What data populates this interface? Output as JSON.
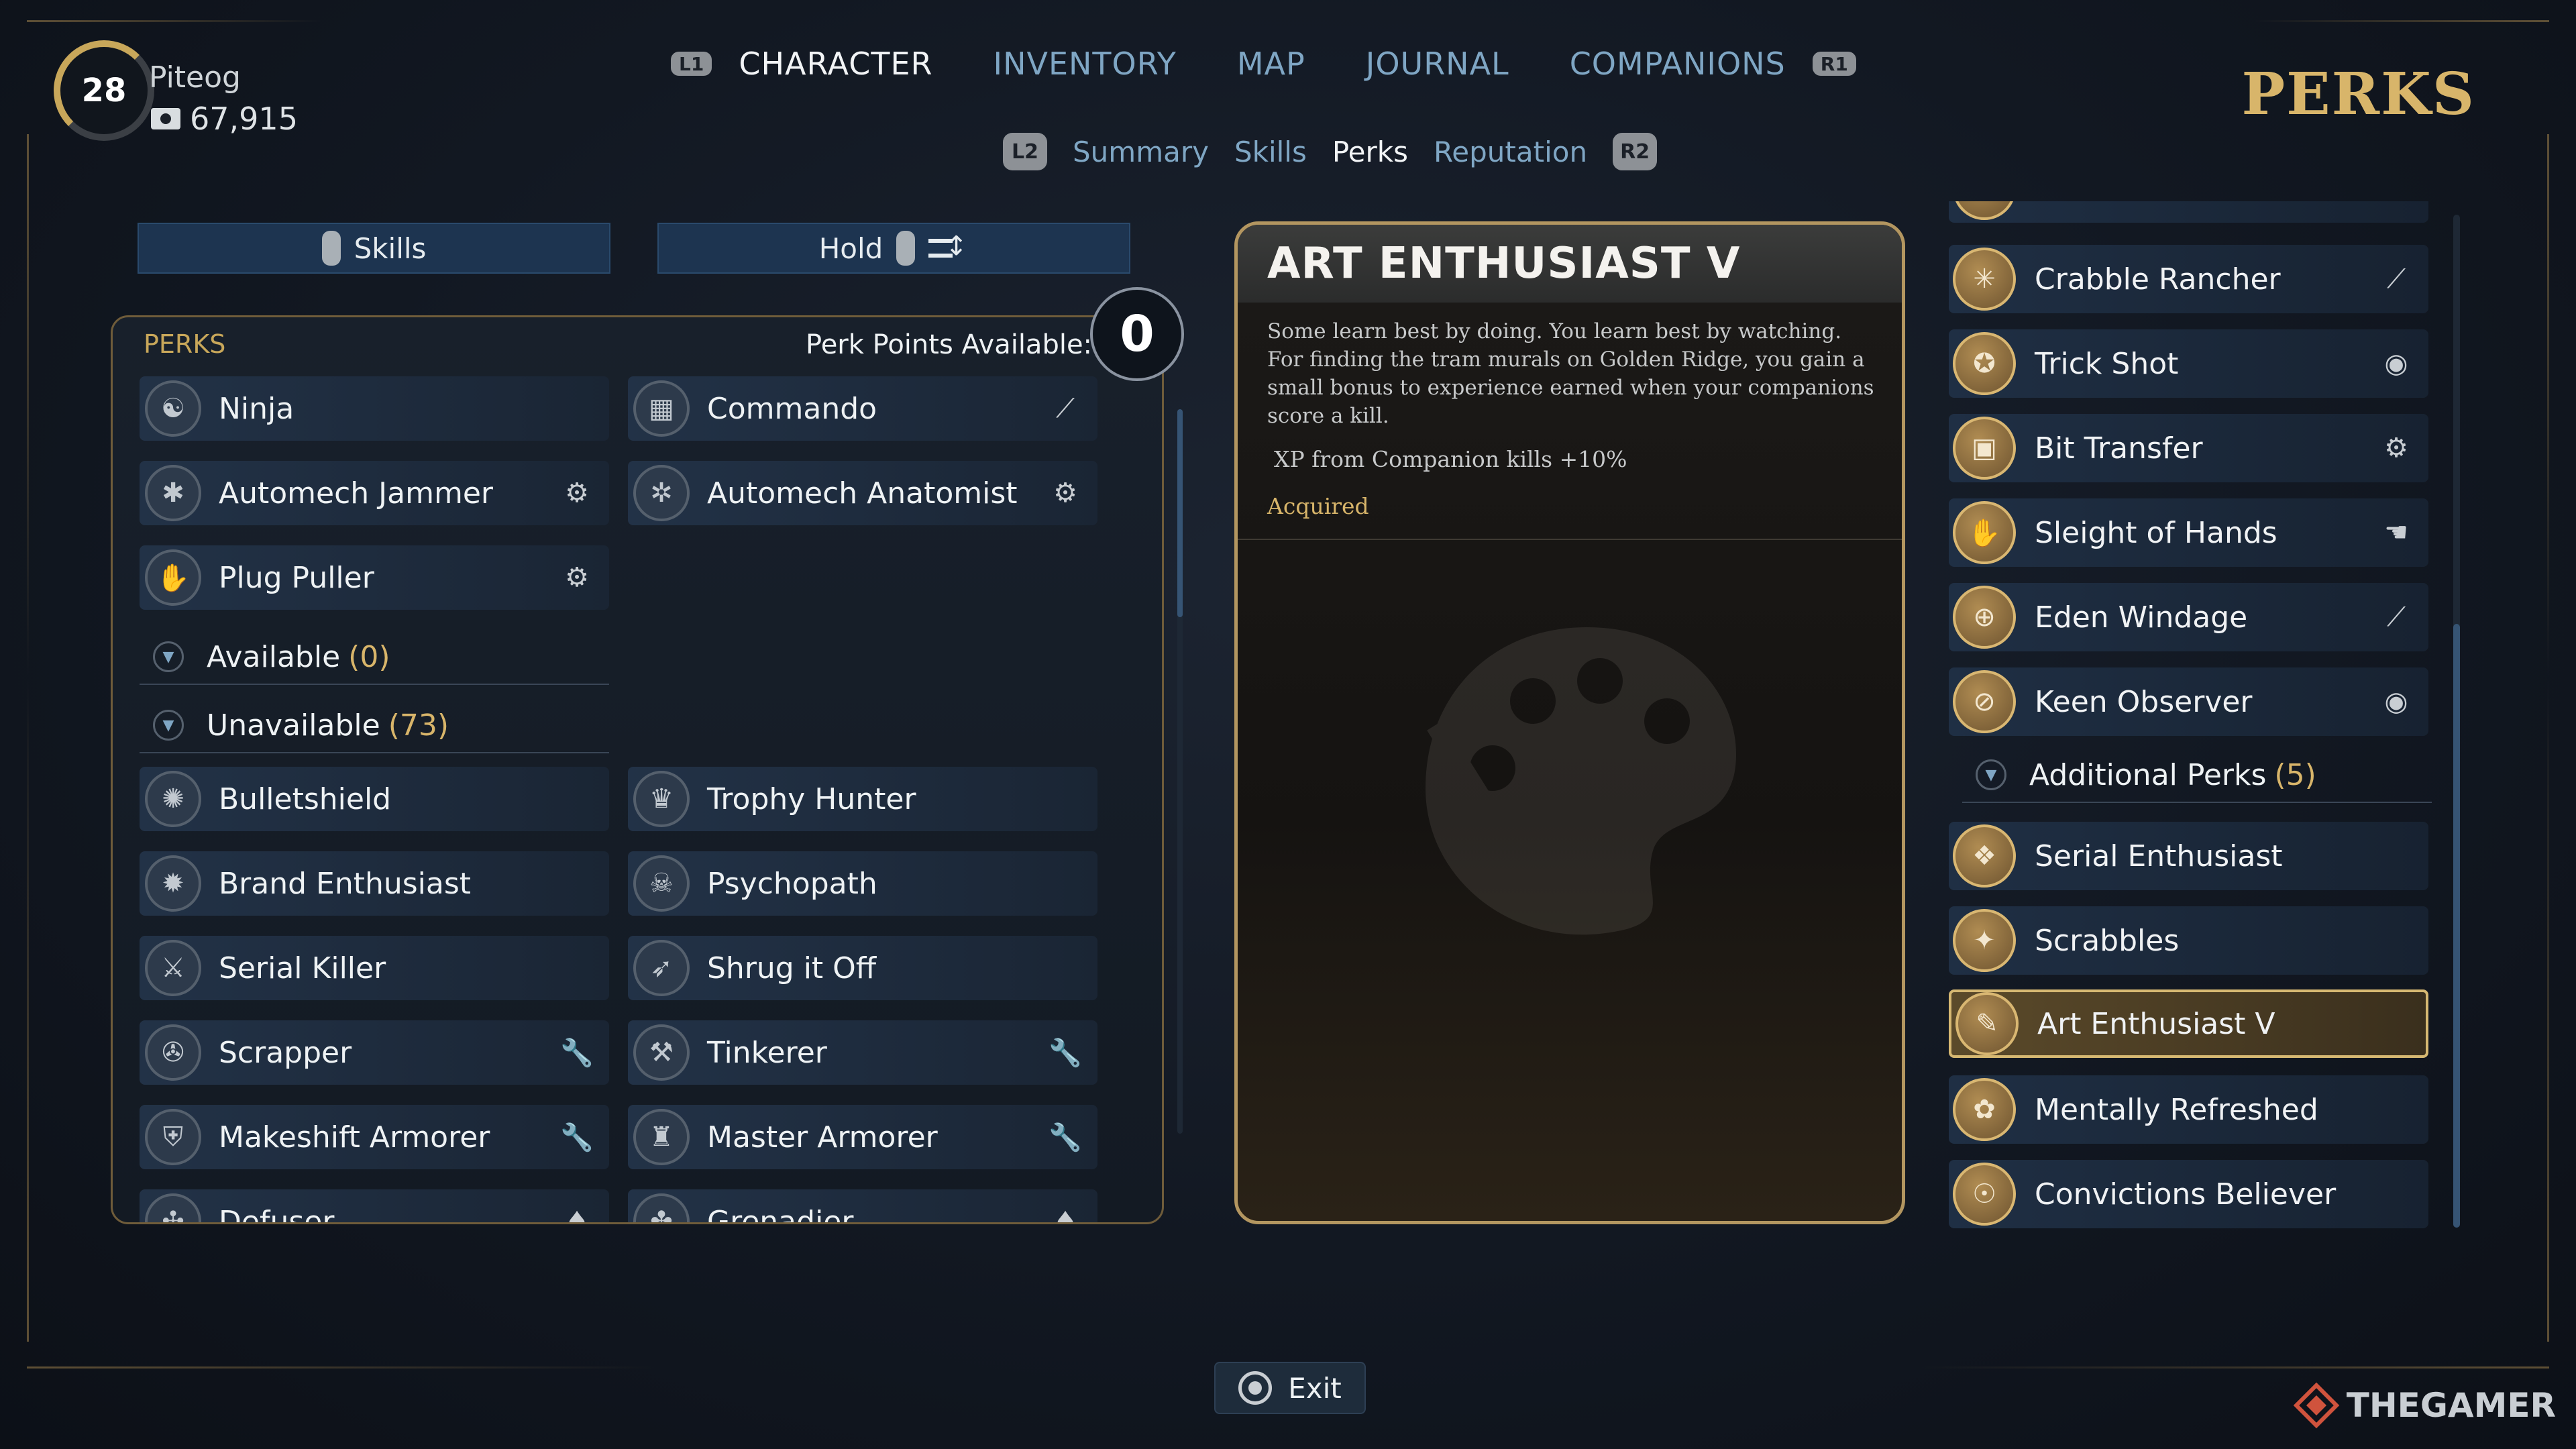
{
  "player": {
    "level": "28",
    "name": "Piteog",
    "credits": "67,915"
  },
  "top_nav": {
    "left_hint": "L1",
    "right_hint": "R1",
    "tabs": [
      {
        "label": "CHARACTER"
      },
      {
        "label": "INVENTORY"
      },
      {
        "label": "MAP"
      },
      {
        "label": "JOURNAL"
      },
      {
        "label": "COMPANIONS"
      }
    ]
  },
  "sub_nav": {
    "left_hint": "L2",
    "right_hint": "R2",
    "tabs": [
      {
        "label": "Summary"
      },
      {
        "label": "Skills"
      },
      {
        "label": "Perks"
      },
      {
        "label": "Reputation"
      }
    ]
  },
  "page_heading": "PERKS",
  "filters": {
    "skills_label": "Skills",
    "hold_label": "Hold"
  },
  "perks_panel": {
    "title": "PERKS",
    "points_label": "Perk Points Available:",
    "points_value": "0",
    "acquired_rows": [
      [
        "Ninja",
        "Commando"
      ],
      [
        "Automech Jammer",
        "Automech Anatomist"
      ],
      [
        "Plug Puller",
        ""
      ]
    ],
    "available_label": "Available",
    "available_count": "(0)",
    "unavailable_label": "Unavailable",
    "unavailable_count": "(73)",
    "unavailable_rows": [
      [
        "Bulletshield",
        "Trophy Hunter"
      ],
      [
        "Brand Enthusiast",
        "Psychopath"
      ],
      [
        "Serial Killer",
        "Shrug it Off"
      ],
      [
        "Scrapper",
        "Tinkerer"
      ],
      [
        "Makeshift Armorer",
        "Master Armorer"
      ],
      [
        "Defuser",
        "Grenadier"
      ]
    ]
  },
  "detail": {
    "title": "ART ENTHUSIAST V",
    "description": "Some learn best by doing. You learn best by watching. For finding the tram murals on Golden Ridge, you gain a small bonus to experience earned when your companions score a kill.",
    "effect": "XP from Companion kills +10%",
    "status": "Acquired"
  },
  "right_list": {
    "items_top": [
      "Crabble Rancher",
      "Trick Shot",
      "Bit Transfer",
      "Sleight of Hands",
      "Eden Windage",
      "Keen Observer"
    ],
    "group_label": "Additional Perks",
    "group_count": "(5)",
    "items_bottom": [
      "Serial Enthusiast",
      "Scrabbles",
      "Art Enthusiast V",
      "Mentally Refreshed",
      "Convictions Believer"
    ]
  },
  "exit_label": "Exit",
  "watermark": "THEGAMER",
  "colors": {
    "gold": "#d8b56a",
    "blue_text": "#7fa6c4",
    "card": "#223247",
    "selected_border": "#d6b872"
  }
}
